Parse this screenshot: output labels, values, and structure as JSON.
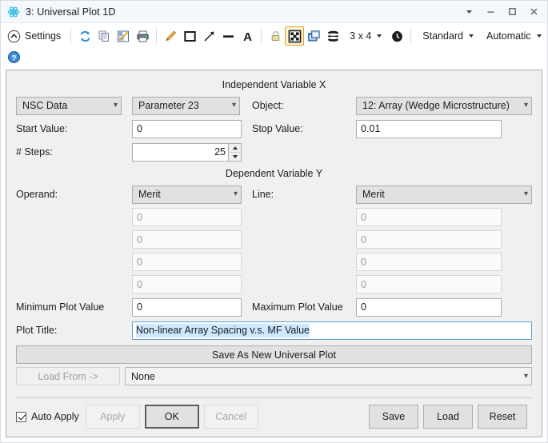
{
  "window": {
    "title": "3: Universal Plot 1D",
    "app_icon": "molecule-icon",
    "controls": {
      "menu": "dropdown-arrow-icon",
      "minimize": "minimize-icon",
      "maximize": "maximize-icon",
      "close": "close-icon"
    }
  },
  "toolbar": {
    "settings_label": "Settings",
    "grid_label": "3 x 4",
    "style_label": "Standard",
    "scale_label": "Automatic",
    "icons": [
      "settings-collapse-icon",
      "refresh-icon",
      "copy-icon",
      "save-chart-icon",
      "print-icon",
      "annotate-pencil-icon",
      "rectangle-icon",
      "arrow-icon",
      "line-icon",
      "text-a-icon",
      "lock-icon",
      "fit-window-icon",
      "detach-window-icon",
      "layers-icon",
      "clock-icon",
      "help-icon"
    ]
  },
  "independent": {
    "section_title": "Independent Variable X",
    "source": "NSC Data",
    "parameter": "Parameter 23",
    "object_label": "Object:",
    "object_value": "12: Array (Wedge Microstructure)",
    "start_label": "Start Value:",
    "start_value": "0",
    "stop_label": "Stop Value:",
    "stop_value": "0.01",
    "steps_label": "# Steps:",
    "steps_value": "25"
  },
  "dependent": {
    "section_title": "Dependent Variable Y",
    "operand_label": "Operand:",
    "operand_value": "Merit",
    "line_label": "Line:",
    "line_value": "Merit",
    "left_values": [
      "0",
      "0",
      "0",
      "0"
    ],
    "right_values": [
      "0",
      "0",
      "0",
      "0"
    ],
    "min_label": "Minimum Plot Value",
    "min_value": "0",
    "max_label": "Maximum Plot Value",
    "max_value": "0"
  },
  "plot_title": {
    "label": "Plot Title:",
    "value": "Non-linear Array Spacing v.s. MF Value"
  },
  "save_as": {
    "button_label": "Save As New Universal Plot",
    "load_from_label": "Load From ->",
    "load_from_value": "None"
  },
  "footer": {
    "auto_apply_label": "Auto Apply",
    "apply_label": "Apply",
    "ok_label": "OK",
    "cancel_label": "Cancel",
    "save_label": "Save",
    "load_label": "Load",
    "reset_label": "Reset"
  },
  "colors": {
    "titlebar": "#f3f8fc",
    "panel_bg": "#f0f0f0",
    "selection": "#cde8ff",
    "accent_active": "#e3a21a"
  }
}
